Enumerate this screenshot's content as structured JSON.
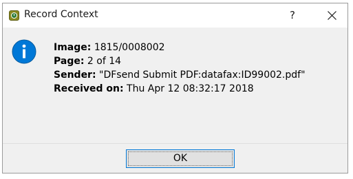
{
  "window": {
    "title": "Record Context",
    "help_label": "?",
    "app_icon": "clock-app-icon",
    "close_icon": "close-icon"
  },
  "message": {
    "icon": "info-icon",
    "icon_color": "#0078d7",
    "fields": [
      {
        "label": "Image:",
        "value": "1815/0008002"
      },
      {
        "label": "Page:",
        "value": "2 of 14"
      },
      {
        "label": "Sender:",
        "value": "\"DFsend Submit PDF:datafax:ID99002.pdf\""
      },
      {
        "label": "Received on:",
        "value": "Thu Apr 12 08:32:17 2018"
      }
    ]
  },
  "buttons": {
    "ok_label": "OK"
  }
}
